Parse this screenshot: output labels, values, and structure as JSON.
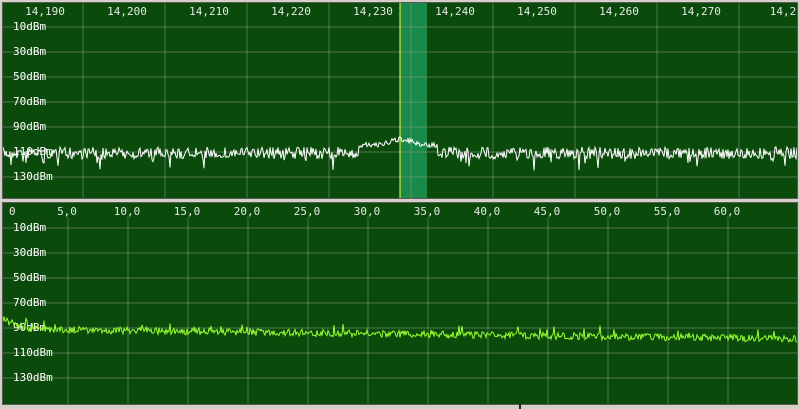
{
  "spectrum": {
    "freq_ticks": [
      "14,190",
      "14,200",
      "14,210",
      "14,220",
      "14,230",
      "14,240",
      "14,250",
      "14,260",
      "14,270",
      "14,2"
    ],
    "db_ticks": [
      "10dBm",
      "30dBm",
      "50dBm",
      "70dBm",
      "90dBm",
      "110dBm",
      "130dBm"
    ],
    "trace_color": "#ffffff",
    "passband_color": "#1a8a4a",
    "cursor_color": "#ffff40"
  },
  "audio": {
    "freq_ticks": [
      "0",
      "5,0",
      "10,0",
      "15,0",
      "20,0",
      "25,0",
      "30,0",
      "35,0",
      "40,0",
      "45,0",
      "50,0",
      "55,0",
      "60,0"
    ],
    "db_ticks": [
      "10dBm",
      "30dBm",
      "50dBm",
      "70dBm",
      "90dBm",
      "110dBm",
      "130dBm"
    ],
    "trace_color": "#99ff33"
  }
}
